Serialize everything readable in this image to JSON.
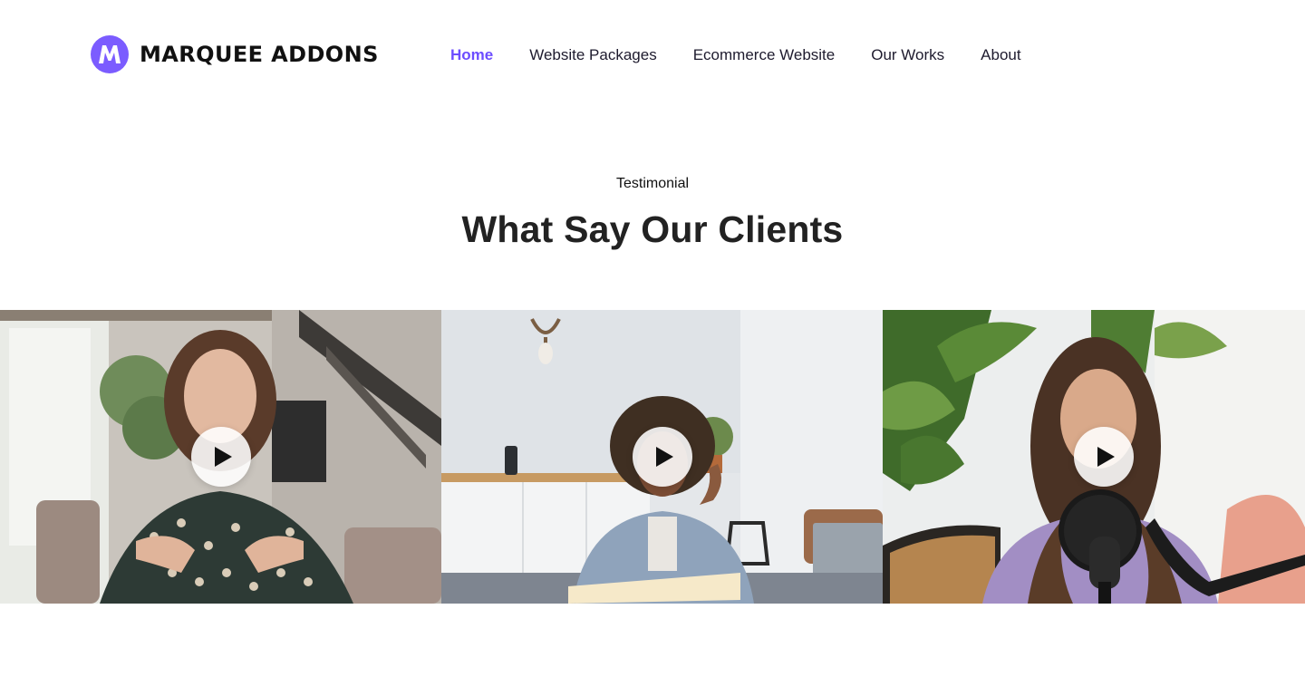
{
  "brand": {
    "name": "MARQUEE ADDONS",
    "logo_icon": "marquee-m-logo",
    "accent": "#7b5cff"
  },
  "nav": {
    "items": [
      {
        "label": "Home",
        "active": true
      },
      {
        "label": "Website Packages",
        "active": false
      },
      {
        "label": "Ecommerce Website",
        "active": false
      },
      {
        "label": "Our Works",
        "active": false
      },
      {
        "label": "About",
        "active": false
      }
    ],
    "active_color": "#6c4dff"
  },
  "section": {
    "eyebrow": "Testimonial",
    "title": "What Say Our Clients"
  },
  "videos": [
    {
      "icon": "play-icon"
    },
    {
      "icon": "play-icon"
    },
    {
      "icon": "play-icon"
    }
  ]
}
